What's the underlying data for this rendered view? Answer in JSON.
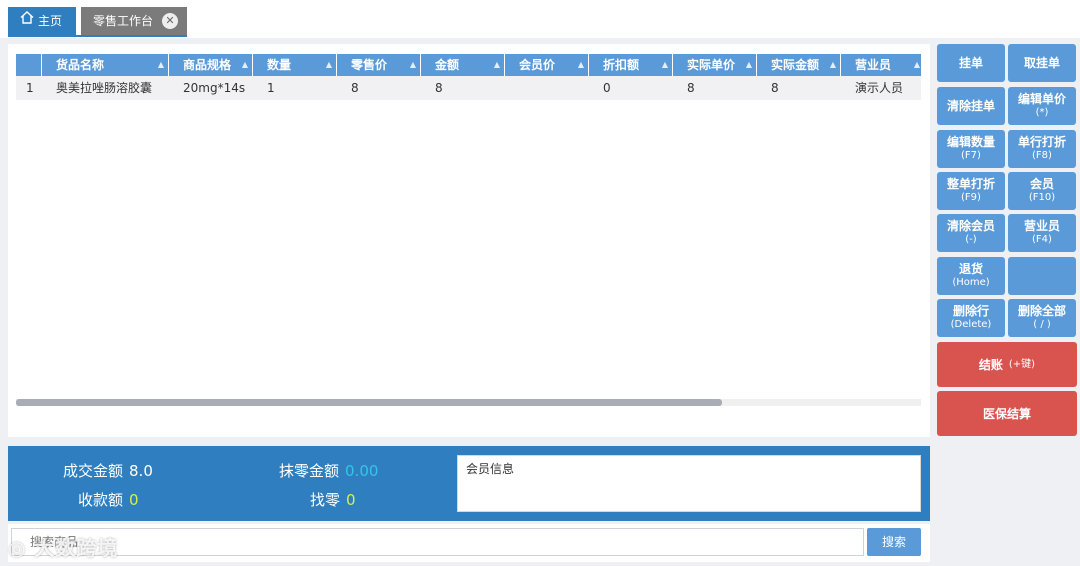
{
  "tabs": [
    {
      "label": "主页",
      "icon": "home-icon"
    },
    {
      "label": "零售工作台",
      "icon": "close-icon"
    }
  ],
  "grid": {
    "columns": [
      "",
      "货品名称",
      "商品规格",
      "数量",
      "零售价",
      "金额",
      "会员价",
      "折扣额",
      "实际单价",
      "实际金额",
      "营业员"
    ],
    "rows": [
      [
        "1",
        "奥美拉唑肠溶胶囊",
        "20mg*14s",
        "1",
        "8",
        "8",
        "",
        "0",
        "8",
        "8",
        "演示人员"
      ]
    ],
    "scroll_fraction": 0.78
  },
  "summary": {
    "deal_label": "成交金额",
    "deal_value": "8.0",
    "round_label": "抹零金额",
    "round_value": "0.00",
    "paid_label": "收款额",
    "paid_value": "0",
    "change_label": "找零",
    "change_value": "0",
    "member_info_label": "会员信息"
  },
  "search": {
    "placeholder": "搜索商品",
    "button": "搜索"
  },
  "buttons": {
    "hang": "挂单",
    "take": "取挂单",
    "clear_hang": "清除挂单",
    "edit_price": "编辑单价",
    "edit_price_key": "(*)",
    "edit_qty": "编辑数量",
    "edit_qty_key": "(F7)",
    "row_discount": "单行打折",
    "row_discount_key": "(F8)",
    "order_discount": "整单打折",
    "order_discount_key": "(F9)",
    "member": "会员",
    "member_key": "(F10)",
    "clear_member": "清除会员",
    "clear_member_key": "(-)",
    "salesperson": "营业员",
    "salesperson_key": "(F4)",
    "return": "退货",
    "return_key": "(Home)",
    "delete_row": "删除行",
    "delete_row_key": "(Delete)",
    "delete_all": "删除全部",
    "delete_all_key": "( / )",
    "checkout": "结账",
    "checkout_key": "(+键)",
    "insurance_checkout": "医保结算"
  },
  "colors": {
    "primary": "#2f7fc0",
    "button": "#5b9ad8",
    "danger": "#d9534f",
    "round_value": "#31c7e6",
    "paid_value": "#d8ef4f"
  },
  "watermark": "大数跨境"
}
